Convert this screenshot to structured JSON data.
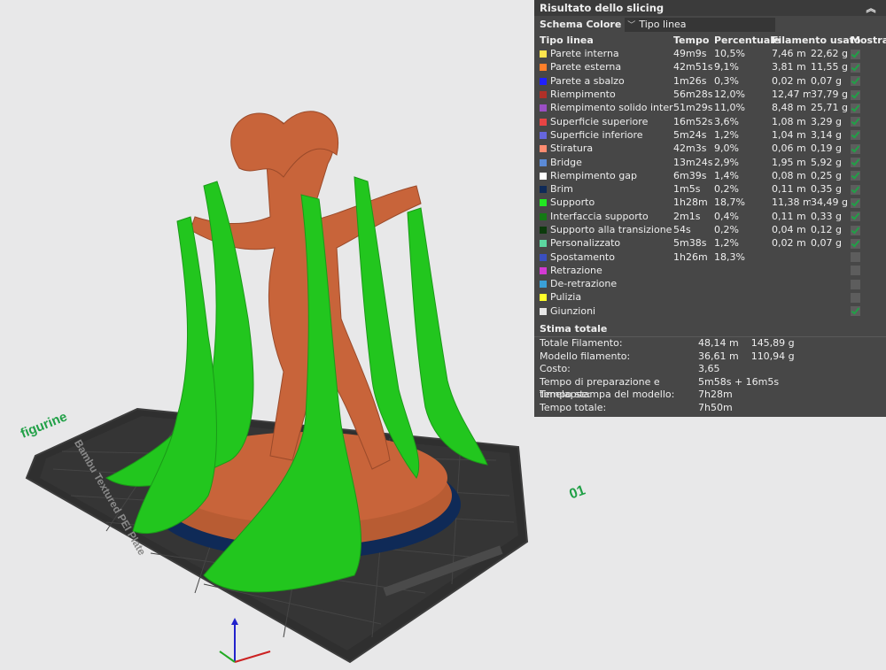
{
  "panel": {
    "title": "Risultato dello slicing",
    "collapse_icon": "double-chevron-up-icon",
    "scheme_label": "Schema Colore",
    "scheme_value": "Tipo linea",
    "headers": [
      "Tipo linea",
      "Tempo",
      "Percentuale",
      "Filamento usato",
      "Mostra"
    ],
    "rows": [
      {
        "name": "Parete interna",
        "color": "#ffe54d",
        "time": "49m9s",
        "pct": "10,5%",
        "len": "7,46 m",
        "wt": "22,62 g",
        "show": true
      },
      {
        "name": "Parete esterna",
        "color": "#ff7f2a",
        "time": "42m51s",
        "pct": "9,1%",
        "len": "3,81 m",
        "wt": "11,55 g",
        "show": true
      },
      {
        "name": "Parete a sbalzo",
        "color": "#2020ff",
        "time": "1m26s",
        "pct": "0,3%",
        "len": "0,02 m",
        "wt": "0,07 g",
        "show": true
      },
      {
        "name": "Riempimento",
        "color": "#b03028",
        "time": "56m28s",
        "pct": "12,0%",
        "len": "12,47 m",
        "wt": "37,79 g",
        "show": true
      },
      {
        "name": "Riempimento solido interno",
        "color": "#9a4fc4",
        "time": "51m29s",
        "pct": "11,0%",
        "len": "8,48 m",
        "wt": "25,71 g",
        "show": true
      },
      {
        "name": "Superficie superiore",
        "color": "#e84444",
        "time": "16m52s",
        "pct": "3,6%",
        "len": "1,08 m",
        "wt": "3,29 g",
        "show": true
      },
      {
        "name": "Superficie inferiore",
        "color": "#6666dd",
        "time": "5m24s",
        "pct": "1,2%",
        "len": "1,04 m",
        "wt": "3,14 g",
        "show": true
      },
      {
        "name": "Stiratura",
        "color": "#ff8c70",
        "time": "42m3s",
        "pct": "9,0%",
        "len": "0,06 m",
        "wt": "0,19 g",
        "show": true
      },
      {
        "name": "Bridge",
        "color": "#5b8ad6",
        "time": "13m24s",
        "pct": "2,9%",
        "len": "1,95 m",
        "wt": "5,92 g",
        "show": true
      },
      {
        "name": "Riempimento gap",
        "color": "#ffffff",
        "time": "6m39s",
        "pct": "1,4%",
        "len": "0,08 m",
        "wt": "0,25 g",
        "show": true
      },
      {
        "name": "Brim",
        "color": "#0f2a57",
        "time": "1m5s",
        "pct": "0,2%",
        "len": "0,11 m",
        "wt": "0,35 g",
        "show": true
      },
      {
        "name": "Supporto",
        "color": "#22e822",
        "time": "1h28m",
        "pct": "18,7%",
        "len": "11,38 m",
        "wt": "34,49 g",
        "show": true
      },
      {
        "name": "Interfaccia supporto",
        "color": "#147a14",
        "time": "2m1s",
        "pct": "0,4%",
        "len": "0,11 m",
        "wt": "0,33 g",
        "show": true
      },
      {
        "name": "Supporto alla transizione",
        "color": "#0c3a0c",
        "time": "54s",
        "pct": "0,2%",
        "len": "0,04 m",
        "wt": "0,12 g",
        "show": true
      },
      {
        "name": "Personalizzato",
        "color": "#5cd6a0",
        "time": "5m38s",
        "pct": "1,2%",
        "len": "0,02 m",
        "wt": "0,07 g",
        "show": true
      },
      {
        "name": "Spostamento",
        "color": "#3a4fc0",
        "time": "1h26m",
        "pct": "18,3%",
        "len": "",
        "wt": "",
        "show": false
      },
      {
        "name": "Retrazione",
        "color": "#d23ad2",
        "time": "",
        "pct": "",
        "len": "",
        "wt": "",
        "show": false
      },
      {
        "name": "De-retrazione",
        "color": "#3aa0d8",
        "time": "",
        "pct": "",
        "len": "",
        "wt": "",
        "show": false
      },
      {
        "name": "Pulizia",
        "color": "#ffff2a",
        "time": "",
        "pct": "",
        "len": "",
        "wt": "",
        "show": false
      },
      {
        "name": "Giunzioni",
        "color": "#e6e6e6",
        "time": "",
        "pct": "",
        "len": "",
        "wt": "",
        "show": true
      }
    ],
    "summary_title": "Stima totale",
    "summary": [
      {
        "k": "Totale Filamento:",
        "v": "48,14 m    145,89 g"
      },
      {
        "k": "Modello filamento:",
        "v": "36,61 m    110,94 g"
      },
      {
        "k": "Costo:",
        "v": "3,65"
      },
      {
        "k": "Tempo di preparazione e timelapse:",
        "v": "5m58s + 16m5s"
      },
      {
        "k": "Tempo stampa del modello:",
        "v": "7h28m"
      },
      {
        "k": "Tempo totale:",
        "v": "7h50m"
      }
    ]
  },
  "plate": {
    "object_name": "figurine",
    "plate_number": "01",
    "plate_type": "Bambu Textured PEI Plate"
  },
  "colors": {
    "support": "#22c61e",
    "model": "#c8643a",
    "plate": "#2f2f2f",
    "accent": "#21a047"
  }
}
